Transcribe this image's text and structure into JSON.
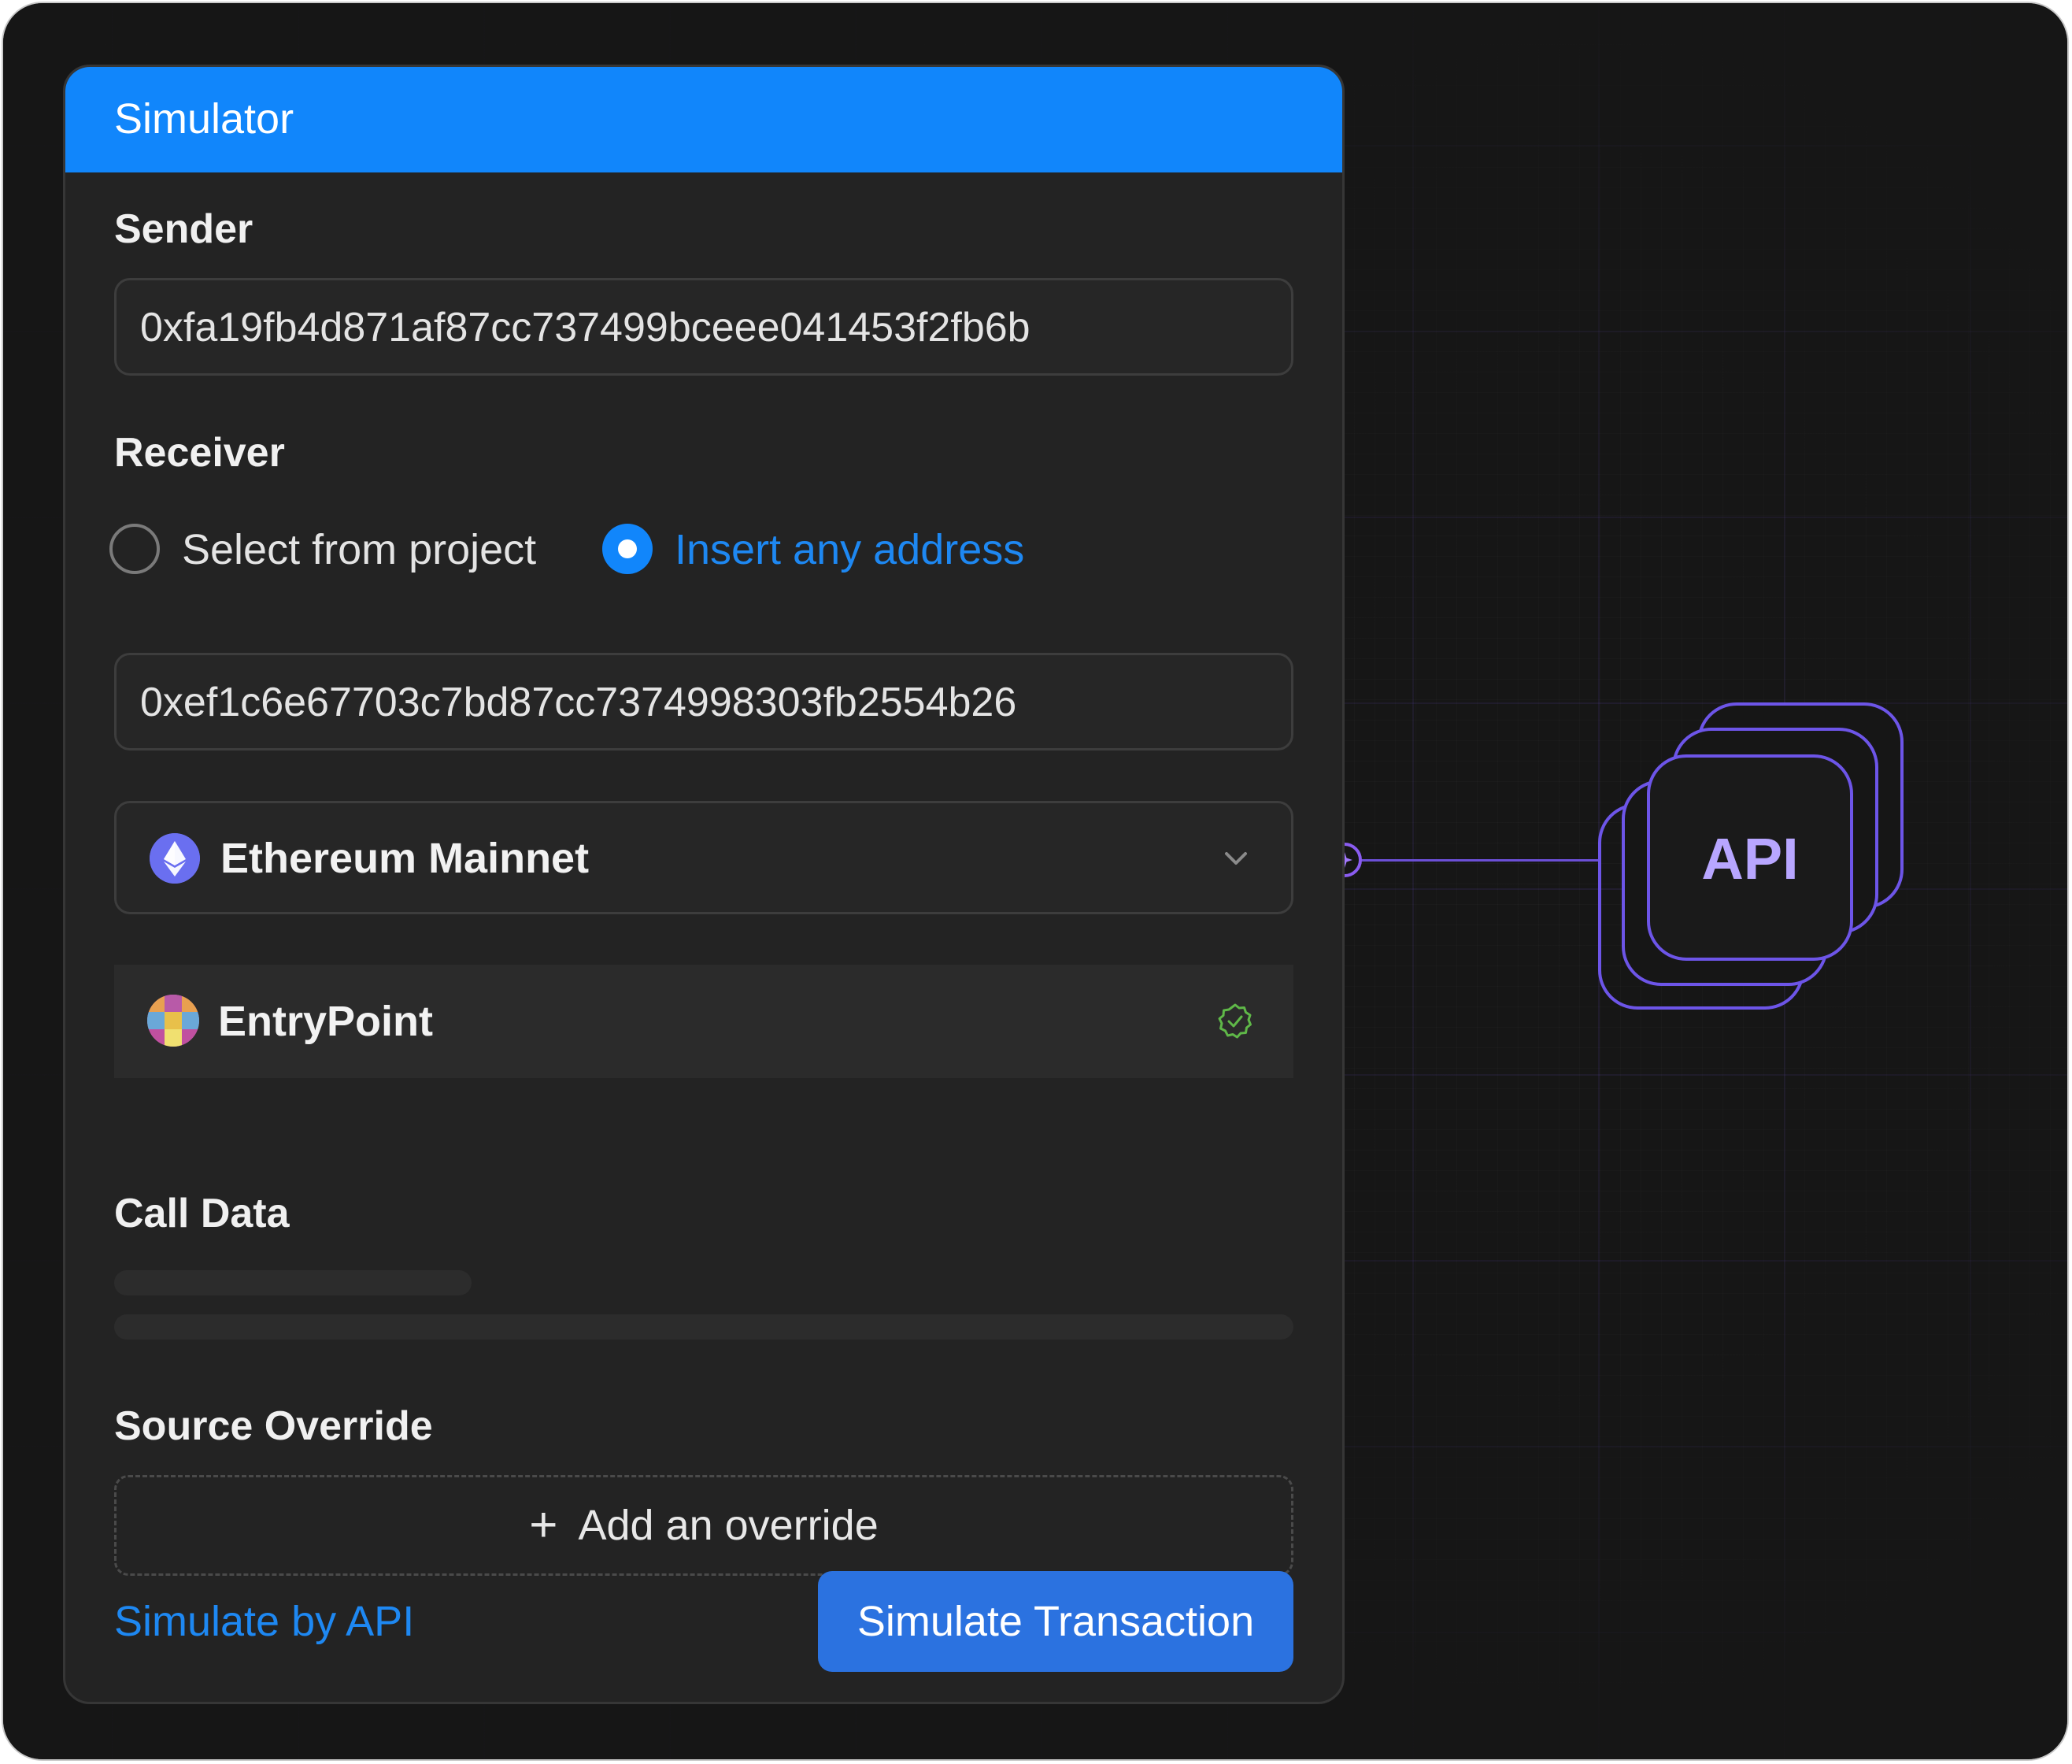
{
  "simulator": {
    "title": "Simulator",
    "sender_label": "Sender",
    "sender_value": "0xfa19fb4d871af87cc737499bceee041453f2fb6b",
    "receiver_label": "Receiver",
    "receiver_options": [
      {
        "label": "Select from project",
        "selected": false
      },
      {
        "label": "Insert any address",
        "selected": true
      }
    ],
    "receiver_value": "0xef1c6e67703c7bd87cc7374998303fb2554b26",
    "network": {
      "label": "Ethereum Mainnet",
      "icon": "ethereum-icon"
    },
    "contract": {
      "name": "EntryPoint",
      "verified": true,
      "icon": "contract-identicon"
    },
    "call_data_label": "Call Data",
    "source_override_label": "Source Override",
    "add_override_label": "Add an override",
    "simulate_api_label": "Simulate by API",
    "simulate_button_label": "Simulate Transaction"
  },
  "api_badge": {
    "label": "API"
  },
  "colors": {
    "accent": "#1186fb",
    "primary_button": "#2b72e0",
    "api_purple": "#6b4fd6",
    "api_text": "#b8a6ff",
    "verified_green": "#5fb848",
    "background": "#161616",
    "card": "#232323"
  }
}
